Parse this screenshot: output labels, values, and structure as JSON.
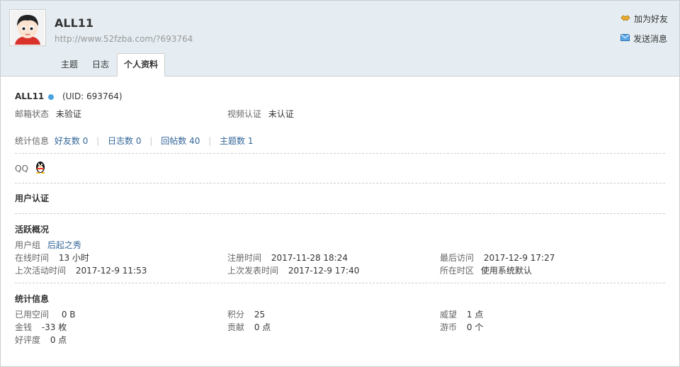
{
  "header": {
    "username": "ALL11",
    "url": "http://www.52fzba.com/?693764",
    "actions": {
      "add_friend": "加为好友",
      "send_message": "发送消息"
    },
    "tabs": [
      "主题",
      "日志",
      "个人资料"
    ],
    "active_tab": "个人资料"
  },
  "profile": {
    "name": "ALL11",
    "uid": "(UID: 693764)",
    "email_label": "邮箱状态",
    "email_value": "未验证",
    "video_label": "视频认证",
    "video_value": "未认证",
    "stats": {
      "label": "统计信息",
      "friends_label": "好友数",
      "friends": "0",
      "blogs_label": "日志数",
      "blogs": "0",
      "replies_label": "回帖数",
      "replies": "40",
      "threads_label": "主题数",
      "threads": "1",
      "divider": "|"
    },
    "qq_label": "QQ"
  },
  "user_auth": {
    "title": "用户认证"
  },
  "activity": {
    "title": "活跃概况",
    "group_label": "用户组",
    "group_value": "后起之秀",
    "online_label": "在线时间",
    "online_value": "13 小时",
    "register_label": "注册时间",
    "register_value": "2017-11-28 18:24",
    "last_visit_label": "最后访问",
    "last_visit_value": "2017-12-9 17:27",
    "last_active_label": "上次活动时间",
    "last_active_value": "2017-12-9 11:53",
    "last_post_label": "上次发表时间",
    "last_post_value": "2017-12-9 17:40",
    "timezone_label": "所在时区",
    "timezone_value": "使用系统默认"
  },
  "statistics": {
    "title": "统计信息",
    "space_label": "已用空间",
    "space_value": "0 B",
    "points_label": "积分",
    "points_value": "25",
    "prestige_label": "威望",
    "prestige_value": "1 点",
    "money_label": "金钱",
    "money_value": "-33 枚",
    "contribution_label": "贡献",
    "contribution_value": "0 点",
    "coins_label": "游币",
    "coins_value": "0 个",
    "rating_label": "好评度",
    "rating_value": "0 点"
  },
  "colors": {
    "header_bg": "#e5edf2",
    "border": "#cdcdcd",
    "link": "#336699",
    "online_dot": "#4aa3df"
  }
}
